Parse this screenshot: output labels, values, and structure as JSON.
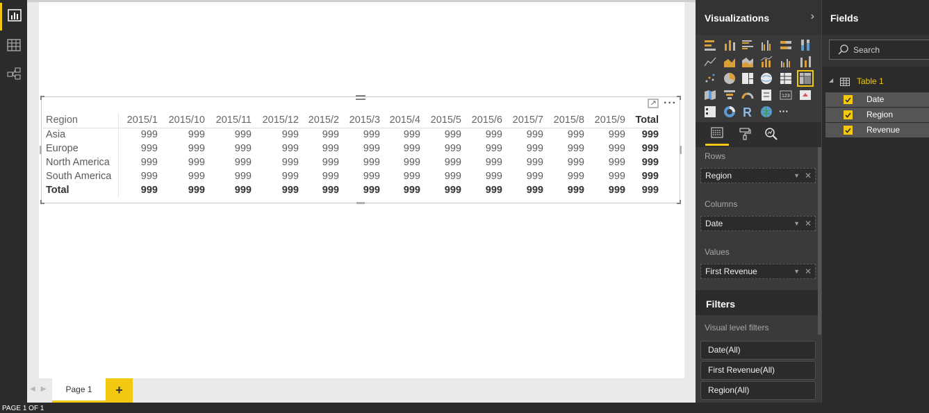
{
  "rail": {
    "items": [
      {
        "name": "report-view",
        "icon": "bar-chart-icon",
        "active": true
      },
      {
        "name": "data-view",
        "icon": "grid-icon",
        "active": false
      },
      {
        "name": "relationships-view",
        "icon": "relationship-icon",
        "active": false
      }
    ]
  },
  "matrix": {
    "row_header": "Region",
    "columns": [
      "2015/1",
      "2015/10",
      "2015/11",
      "2015/12",
      "2015/2",
      "2015/3",
      "2015/4",
      "2015/5",
      "2015/6",
      "2015/7",
      "2015/8",
      "2015/9",
      "Total"
    ],
    "rows": [
      {
        "label": "Asia",
        "values": [
          "999",
          "999",
          "999",
          "999",
          "999",
          "999",
          "999",
          "999",
          "999",
          "999",
          "999",
          "999",
          "999"
        ]
      },
      {
        "label": "Europe",
        "values": [
          "999",
          "999",
          "999",
          "999",
          "999",
          "999",
          "999",
          "999",
          "999",
          "999",
          "999",
          "999",
          "999"
        ]
      },
      {
        "label": "North America",
        "values": [
          "999",
          "999",
          "999",
          "999",
          "999",
          "999",
          "999",
          "999",
          "999",
          "999",
          "999",
          "999",
          "999"
        ]
      },
      {
        "label": "South America",
        "values": [
          "999",
          "999",
          "999",
          "999",
          "999",
          "999",
          "999",
          "999",
          "999",
          "999",
          "999",
          "999",
          "999"
        ]
      }
    ],
    "total_row": {
      "label": "Total",
      "values": [
        "999",
        "999",
        "999",
        "999",
        "999",
        "999",
        "999",
        "999",
        "999",
        "999",
        "999",
        "999",
        "999"
      ]
    },
    "more_label": "···"
  },
  "pages": {
    "tabs": [
      "Page 1"
    ],
    "add_label": "+",
    "nav_arrows": "◀▶"
  },
  "status": {
    "text": "PAGE 1 OF 1"
  },
  "visualizations": {
    "title": "Visualizations",
    "chevron": "›",
    "more_icon_label": "···",
    "wells": {
      "rows_label": "Rows",
      "rows_value": "Region",
      "columns_label": "Columns",
      "columns_value": "Date",
      "values_label": "Values",
      "values_value": "First Revenue"
    }
  },
  "filters": {
    "title": "Filters",
    "visual_level_label": "Visual level filters",
    "items": [
      "Date(All)",
      "First Revenue(All)",
      "Region(All)"
    ]
  },
  "fields": {
    "title": "Fields",
    "search_placeholder": "Search",
    "table_name": "Table 1",
    "items": [
      "Date",
      "Region",
      "Revenue"
    ]
  },
  "colors": {
    "accent": "#f2c811",
    "panel_dark": "#2b2b2b",
    "panel_mid": "#3a3a3a"
  }
}
